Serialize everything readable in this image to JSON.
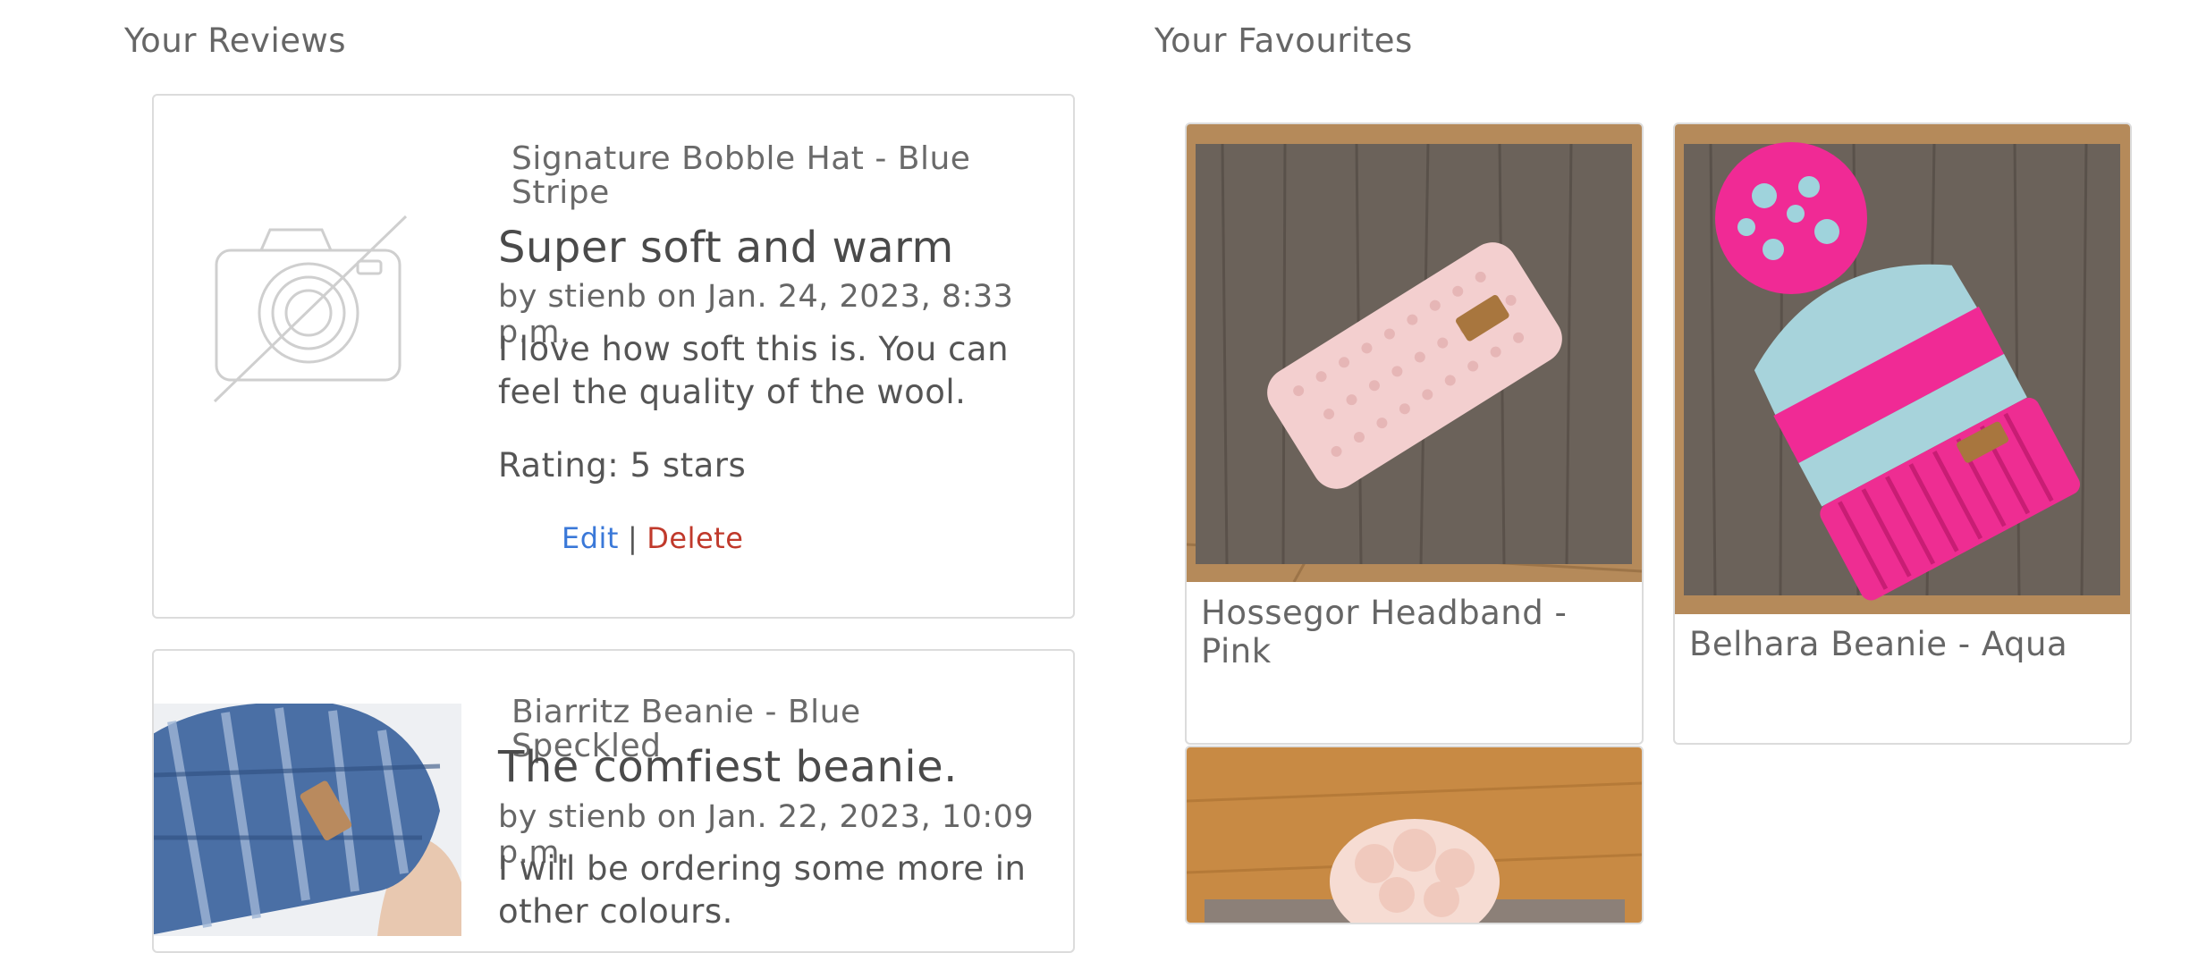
{
  "reviews_section": {
    "title": "Your Reviews",
    "reviews": [
      {
        "product": "Signature Bobble Hat - Blue Stripe",
        "title": "Super soft and warm",
        "meta": "by stienb on Jan. 24, 2023, 8:33 p.m.",
        "body": "I love how soft this is. You can feel the quality of the wool.",
        "rating": "Rating: 5 stars",
        "edit_label": "Edit",
        "separator": "|",
        "delete_label": "Delete"
      },
      {
        "product": "Biarritz Beanie - Blue Speckled",
        "title": "The comfiest beanie.",
        "meta": "by stienb on Jan. 22, 2023, 10:09 p.m.",
        "body": "I will be ordering some more in other colours."
      }
    ]
  },
  "favourites_section": {
    "title": "Your Favourites",
    "items": [
      {
        "name": "Hossegor Headband - Pink"
      },
      {
        "name": "Belhara Beanie - Aqua"
      },
      {
        "name": ""
      }
    ]
  }
}
